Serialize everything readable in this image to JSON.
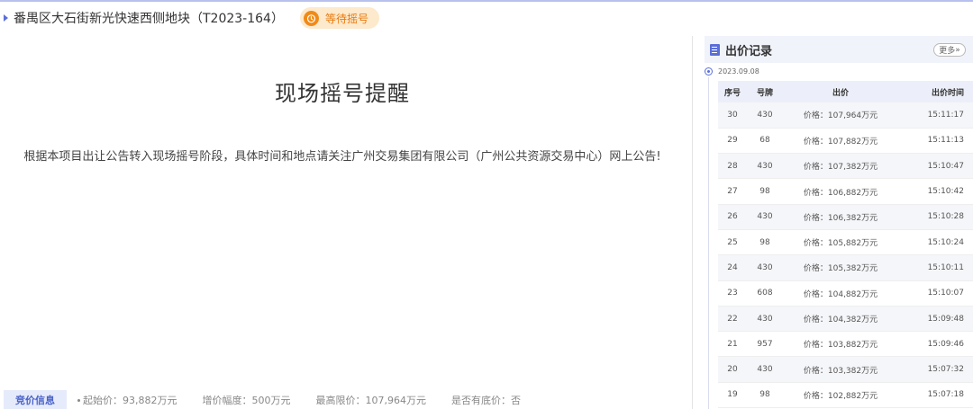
{
  "header": {
    "project_title": "番禺区大石街新光快速西侧地块（T2023-164）",
    "status": "等待摇号"
  },
  "main": {
    "title": "现场摇号提醒",
    "notice": "根据本项目出让公告转入现场摇号阶段，具体时间和地点请关注广州交易集团有限公司（广州公共资源交易中心）网上公告!"
  },
  "bottom_bar": {
    "tab": "竞价信息",
    "start_price": "起始价：93,882万元",
    "increment": "增价幅度：500万元",
    "max_price": "最高限价：107,964万元",
    "reserve": "是否有底价：否"
  },
  "bid_panel": {
    "title": "出价记录",
    "more": "更多",
    "date": "2023.09.08",
    "columns": {
      "seq": "序号",
      "plate": "号牌",
      "price": "出价",
      "time": "出价时间"
    },
    "rows": [
      {
        "seq": "30",
        "plate": "430",
        "price": "价格：107,964万元",
        "time": "15:11:17"
      },
      {
        "seq": "29",
        "plate": "68",
        "price": "价格：107,882万元",
        "time": "15:11:13"
      },
      {
        "seq": "28",
        "plate": "430",
        "price": "价格：107,382万元",
        "time": "15:10:47"
      },
      {
        "seq": "27",
        "plate": "98",
        "price": "价格：106,882万元",
        "time": "15:10:42"
      },
      {
        "seq": "26",
        "plate": "430",
        "price": "价格：106,382万元",
        "time": "15:10:28"
      },
      {
        "seq": "25",
        "plate": "98",
        "price": "价格：105,882万元",
        "time": "15:10:24"
      },
      {
        "seq": "24",
        "plate": "430",
        "price": "价格：105,382万元",
        "time": "15:10:11"
      },
      {
        "seq": "23",
        "plate": "608",
        "price": "价格：104,882万元",
        "time": "15:10:07"
      },
      {
        "seq": "22",
        "plate": "430",
        "price": "价格：104,382万元",
        "time": "15:09:48"
      },
      {
        "seq": "21",
        "plate": "957",
        "price": "价格：103,882万元",
        "time": "15:09:46"
      },
      {
        "seq": "20",
        "plate": "430",
        "price": "价格：103,382万元",
        "time": "15:07:32"
      },
      {
        "seq": "19",
        "plate": "98",
        "price": "价格：102,882万元",
        "time": "15:07:18"
      }
    ]
  },
  "icons": {
    "caret": "caret-right-icon",
    "status": "alarm-clock-icon",
    "panel": "document-icon",
    "timeline": "timeline-dot-icon"
  },
  "colors": {
    "accent": "#5b6fd8",
    "status_bg": "#fde9cc",
    "status_text": "#e8790d",
    "table_header_bg": "#eceff9"
  }
}
